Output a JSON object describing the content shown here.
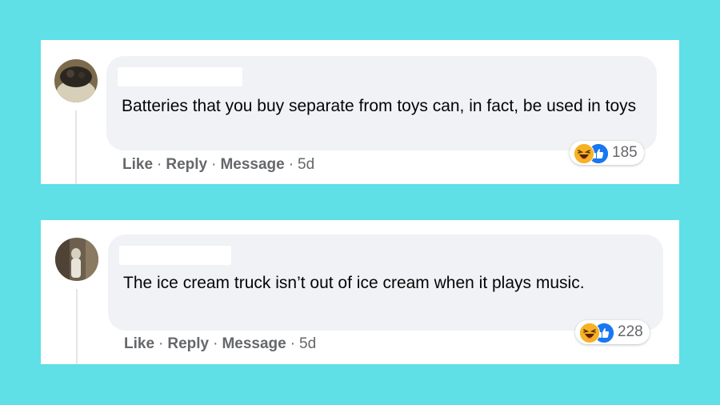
{
  "comments": [
    {
      "text": "Batteries that you buy separate from toys can, in fact, be used in toys",
      "reaction_count": "185",
      "reactions": [
        "haha-icon",
        "like-icon"
      ],
      "actions": {
        "like": "Like",
        "reply": "Reply",
        "message": "Message",
        "age": "5d",
        "separator": "·"
      }
    },
    {
      "text": "The ice cream truck isn’t out of ice cream when it plays music.",
      "reaction_count": "228",
      "reactions": [
        "haha-icon",
        "like-icon"
      ],
      "actions": {
        "like": "Like",
        "reply": "Reply",
        "message": "Message",
        "age": "5d",
        "separator": "·"
      }
    }
  ],
  "colors": {
    "background": "#5ee0e6",
    "bubble": "#f0f2f5",
    "meta_text": "#65676b",
    "like_blue": "#1877f2",
    "haha_yellow": "#f7b125"
  }
}
